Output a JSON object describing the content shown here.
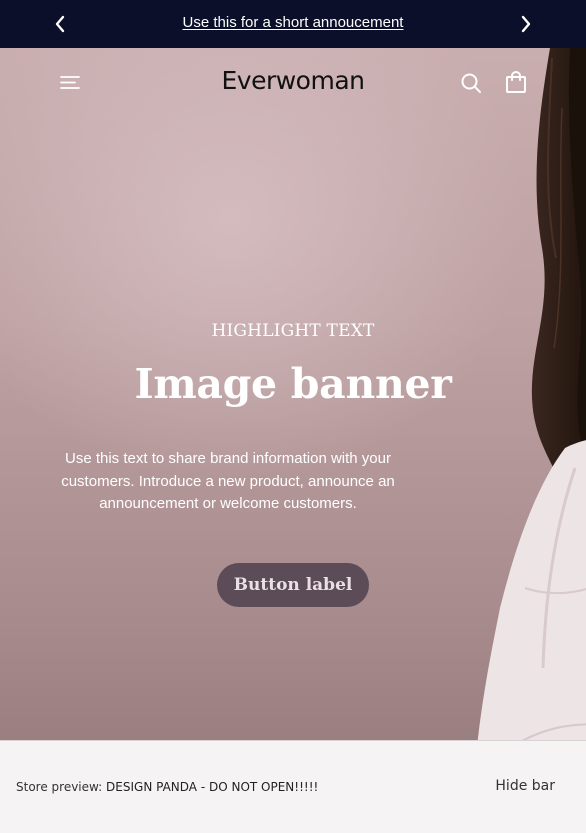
{
  "announcement": {
    "text": "Use this for a short annoucement",
    "prev_icon": "chevron-left-icon",
    "next_icon": "chevron-right-icon"
  },
  "header": {
    "logo": "Everwoman",
    "menu_icon": "hamburger-menu-icon",
    "search_icon": "search-icon",
    "cart_icon": "shopping-bag-icon"
  },
  "hero": {
    "eyebrow": "HIGHLIGHT TEXT",
    "title": "Image banner",
    "body": "Use this text to share brand information with your customers. Introduce a new product, announce an announcement or welcome customers.",
    "button_label": "Button label"
  },
  "preview_bar": {
    "prefix": "Store preview: ",
    "store_name": "DESIGN PANDA - DO NOT OPEN!!!!!",
    "hide_label": "Hide bar"
  },
  "colors": {
    "announcement_bg": "#0b0f2a",
    "button_bg": "#5b4c58",
    "preview_bg": "#f5f3f3"
  }
}
